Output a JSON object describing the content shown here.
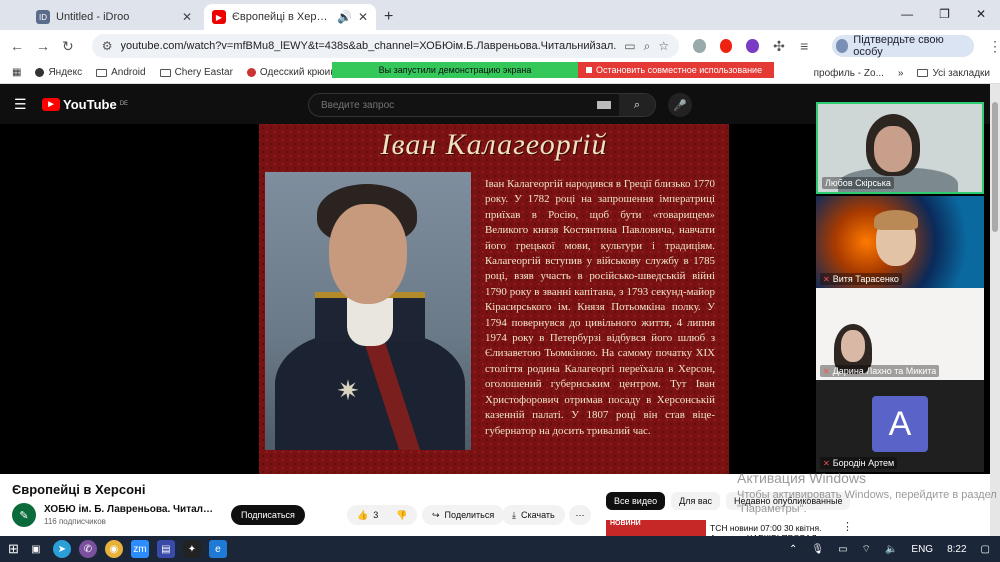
{
  "browser": {
    "tabs": [
      {
        "title": "Untitled",
        "suffix": " - iDroo",
        "favicon": "ID"
      },
      {
        "title": "Європейці в Херсоні - YouTube",
        "favicon": "▶"
      }
    ],
    "new_tab": "+",
    "window_controls": {
      "minimize": "—",
      "restore": "❐",
      "close": "✕"
    },
    "url": "youtube.com/watch?v=mfBMu8_lEWY&t=438s&ab_channel=ХОБЮім.Б.Лавреньова.Читальнийзал.",
    "profile_label": "Підтвердьте свою особу",
    "bookmarks": [
      "Яндекс",
      "Android",
      "Chery Eastar",
      "Одесский крюинг"
    ],
    "bookmarks_tail": "профиль - Zo...",
    "bookmarks_more": "»",
    "all_bookmarks": "Усі закладки"
  },
  "screen_share": {
    "status": "Вы запустили демонстрацию экрана",
    "stop": "Остановить совместное использование"
  },
  "youtube": {
    "logo": "YouTube",
    "region": "DE",
    "search_placeholder": "Введите запрос"
  },
  "slide": {
    "title": "Іван Калагеорґій",
    "text": "Іван Калагеоргій народився в Греції близько 1770 року. У 1782 році на запрошення імператриці приїхав в Росію, щоб бути «товарищем» Великого князя Костянтина Павловича, навчати його грецької мови, культури і традиціям. Калагеоргій вступив у військову службу в 1785 році, взяв участь в російсько-шведській війні 1790 року в званні капітана, з 1793 секунд-майор Кірасирського ім. Князя Потьомкіна полку. У 1794 повернувся до цивільного життя, 4 липня 1974 року в Петербурзі відбувся його шлюб з Єлизаветою Тьомкіною. На самому початку XIX століття родина Калагеоргі переїхала в Херсон, оголошений губернським центром. Тут Іван Христофорович отримав посаду в Херсонській казенній палаті. У 1807 році він став віце-губернатор на досить тривалий час."
  },
  "participants": [
    {
      "name": "Любов Скірська",
      "muted": false
    },
    {
      "name": "Витя Тарасенко",
      "muted": true
    },
    {
      "name": "Дарина Лахно та Микита",
      "muted": true
    },
    {
      "name": "Бородін Артем",
      "muted": true,
      "avatar_letter": "A"
    }
  ],
  "video": {
    "title": "Європейці в Херсоні",
    "channel": "ХОБЮ ім. Б. Лавреньова. Читальний зал",
    "subscribers": "116 подписчиков",
    "subscribe": "Подписаться",
    "likes": "3",
    "share": "Поделиться",
    "download": "Скачать",
    "more": "⋯"
  },
  "filter_chips": [
    "Все видео",
    "Для вас",
    "Недавно опубликованные"
  ],
  "recommendation": {
    "thumb_label": "НОВИНИ",
    "title": "ТСН новини 07:00 30 квітня.",
    "subtitle": "Атака на ХАРКІВ! ПРОВАЛ"
  },
  "windows_watermark": {
    "line1": "Активация Windows",
    "line2": "Чтобы активировать Windows, перейдите в раздел \"Параметры\"."
  },
  "taskbar": {
    "lang": "ENG",
    "time": "8:22"
  },
  "colors": {
    "share_green": "#34c759",
    "share_red": "#e53935",
    "slide_bg": "#7a1214",
    "active_speaker": "#2ecc71"
  }
}
